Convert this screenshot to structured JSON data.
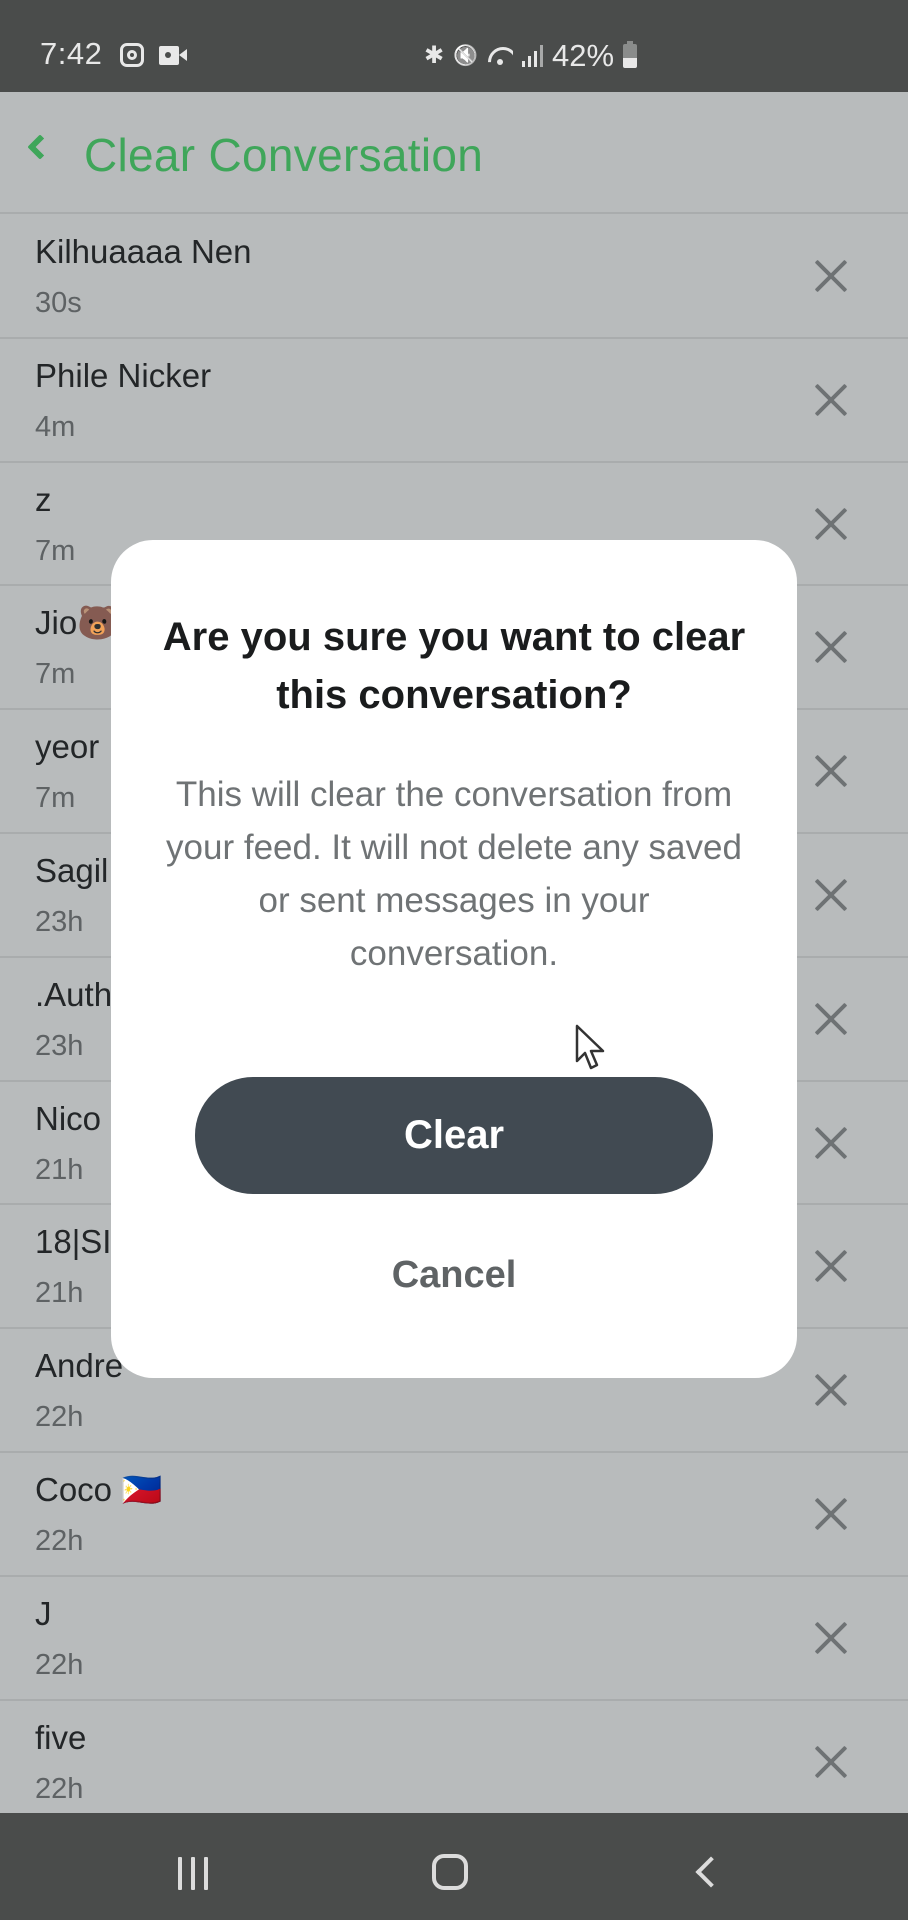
{
  "status_bar": {
    "time": "7:42",
    "left_icons": [
      "instagram-icon",
      "video-camera-icon"
    ],
    "right_icons": [
      "bluetooth-icon",
      "mute-vibrate-icon",
      "wifi-icon",
      "signal-icon"
    ],
    "battery": "42%",
    "bluetooth_glyph": "✱",
    "mute_glyph": "🔇"
  },
  "header": {
    "back_icon": "chevron-left-icon",
    "title": "Clear Conversation",
    "accent_color": "#3fa65a"
  },
  "conversations": [
    {
      "name": "Kilhuaaaa Nen",
      "age": "30s"
    },
    {
      "name": "Phile Nicker",
      "age": "4m"
    },
    {
      "name": "z",
      "age": "7m"
    },
    {
      "name": "Jio🐻",
      "age": "7m"
    },
    {
      "name": "yeor",
      "age": "7m"
    },
    {
      "name": "Sagil",
      "age": "23h"
    },
    {
      "name": ".Auth",
      "age": "23h"
    },
    {
      "name": "Nico",
      "age": "21h"
    },
    {
      "name": "18|SI",
      "age": "21h"
    },
    {
      "name": "Andre",
      "age": "22h"
    },
    {
      "name": "Coco 🇵🇭",
      "age": "22h"
    },
    {
      "name": "J",
      "age": "22h"
    },
    {
      "name": "five",
      "age": "22h"
    }
  ],
  "dialog": {
    "title": "Are you sure you want to clear this conversation?",
    "body": "This will clear the conversation from your feed. It will not delete any saved or sent messages in your conversation.",
    "confirm_label": "Clear",
    "cancel_label": "Cancel",
    "confirm_color": "#414a52"
  },
  "nav_bar": {
    "buttons": [
      "recent-apps",
      "home",
      "back"
    ]
  }
}
